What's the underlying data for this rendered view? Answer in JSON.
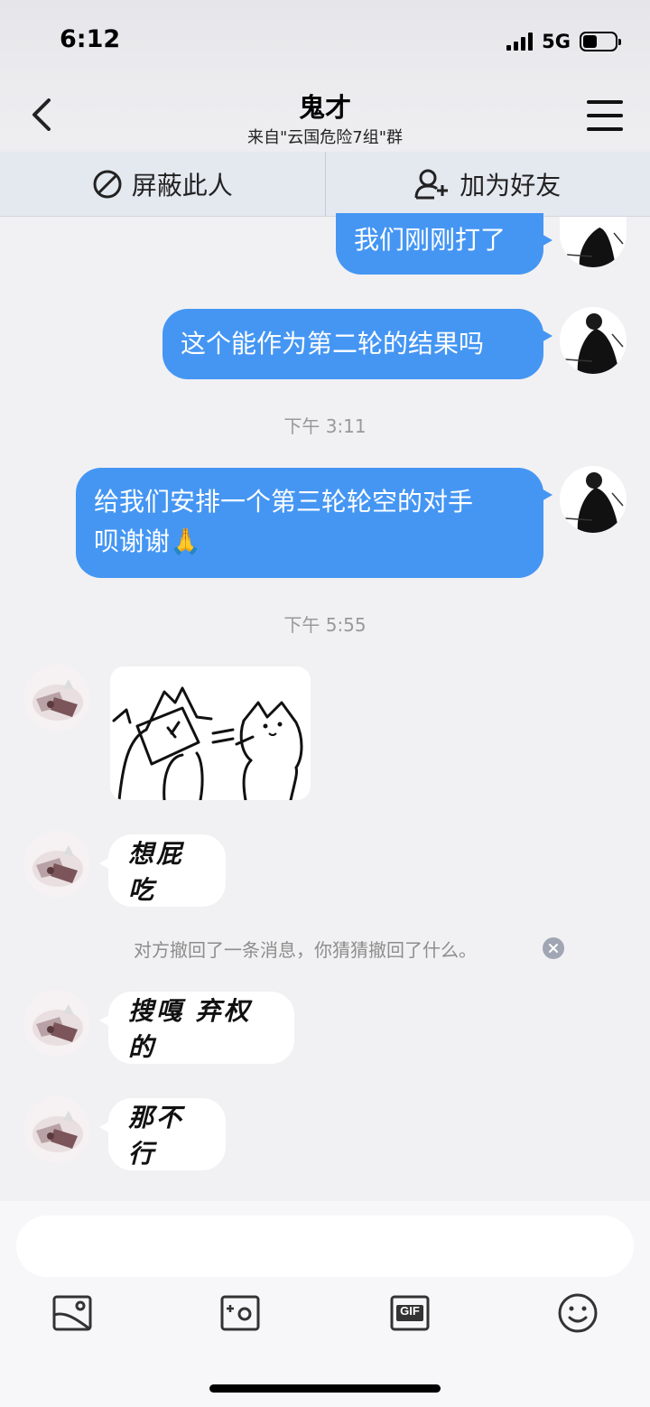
{
  "status_bar": {
    "time": "6:12",
    "network": "5G",
    "battery_level": 0.45
  },
  "header": {
    "title": "鬼才",
    "subtitle": "来自\"云国危险7组\"群"
  },
  "actions": {
    "block_label": "屏蔽此人",
    "add_friend_label": "加为好友"
  },
  "messages": [
    {
      "side": "right",
      "text": "我们刚刚打了"
    },
    {
      "side": "right",
      "text": "这个能作为第二轮的结果吗"
    },
    {
      "type": "time",
      "text": "下午 3:11"
    },
    {
      "side": "right",
      "text_line1": "给我们安排一个第三轮轮空的对手",
      "text_line2": "呗谢谢",
      "emoji": "🙏"
    },
    {
      "type": "time",
      "text": "下午 5:55"
    },
    {
      "side": "left",
      "type": "sticker"
    },
    {
      "side": "left",
      "text": "想屁吃"
    },
    {
      "type": "recall",
      "text": "对方撤回了一条消息，你猜猜撤回了什么。"
    },
    {
      "side": "left",
      "text": "搜嘎 弃权的"
    },
    {
      "side": "left",
      "text": "那不行"
    }
  ],
  "composer": {
    "input_value": "",
    "tools": [
      "image-icon",
      "camera-icon",
      "gif-icon",
      "emoji-icon"
    ],
    "gif_text": "GIF"
  },
  "colors": {
    "bubble_self": "#4596f3",
    "background": "#f1f1f3"
  }
}
